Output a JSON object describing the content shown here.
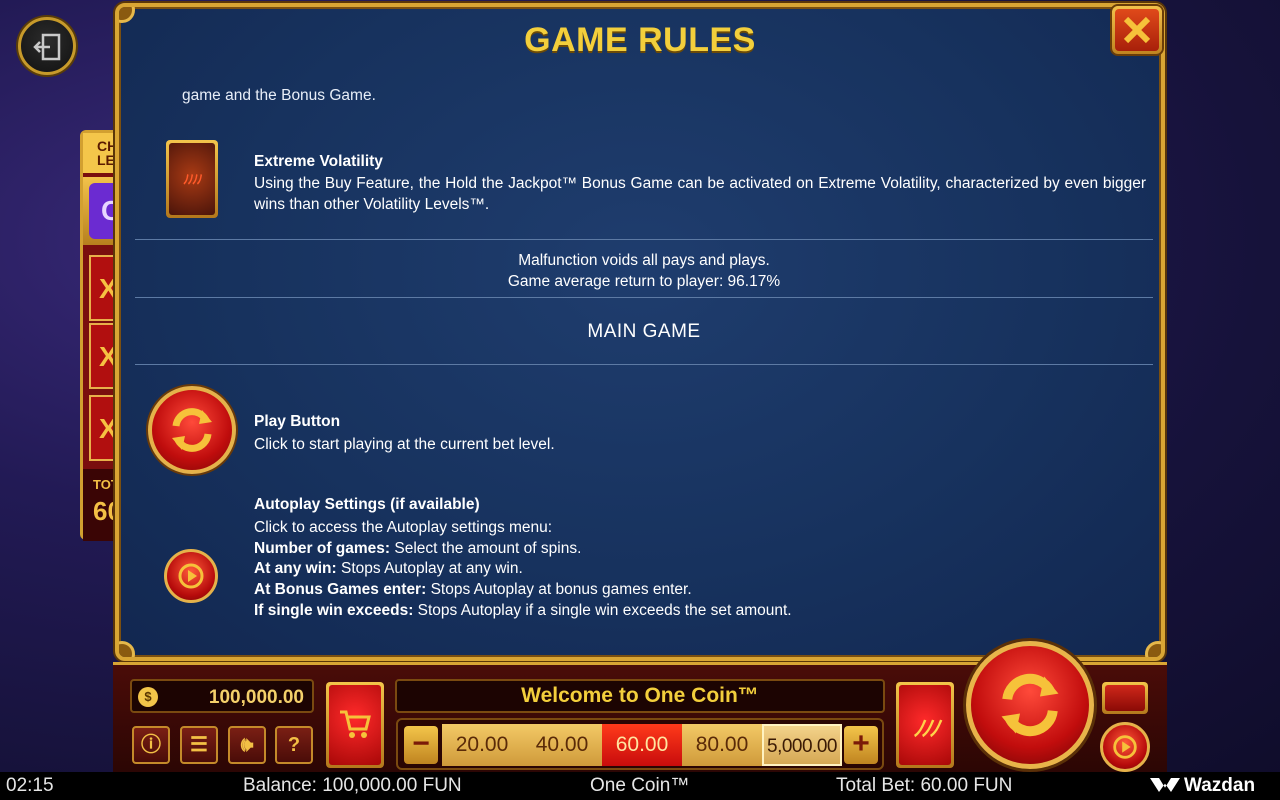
{
  "modal": {
    "title": "GAME RULES",
    "cut_line": "game and the Bonus Game.",
    "extreme_volatility": {
      "title": "Extreme Volatility",
      "desc": "Using the Buy Feature, the Hold the Jackpot™ Bonus Game can be activated on Extreme Volatility, characterized by even bigger wins than other Volatility Levels™."
    },
    "malfunction": "Malfunction voids all pays and plays.",
    "rtp": "Game average return to player: 96.17%",
    "section_main": "MAIN GAME",
    "play_button": {
      "title": "Play Button",
      "desc": "Click to start playing at the current bet level."
    },
    "autoplay": {
      "title": "Autoplay Settings (if available)",
      "intro": "Click to access the Autoplay settings menu:",
      "items": [
        {
          "label": "Number of games:",
          "text": " Select the amount of spins."
        },
        {
          "label": "At any win:",
          "text": " Stops Autoplay at any win."
        },
        {
          "label": "At Bonus Games enter:",
          "text": " Stops Autoplay at bonus games enter."
        },
        {
          "label": "If single win exceeds:",
          "text": " Stops Autoplay if a single win exceeds the set amount."
        }
      ]
    }
  },
  "side_panel": {
    "top": "CH\nLE",
    "purple": "C",
    "cells": [
      "X",
      "X",
      "X"
    ],
    "total_label": "TOT",
    "total_value": "60"
  },
  "bottom": {
    "balance": "100,000.00",
    "welcome": "Welcome to One Coin™",
    "bets": [
      "20.00",
      "40.00",
      "60.00",
      "80.00",
      "5,000.00"
    ],
    "active_bet_index": 2,
    "minus": "−",
    "plus": "+"
  },
  "status": {
    "time": "02:15",
    "balance": "Balance: 100,000.00 FUN",
    "game": "One Coin™",
    "total_bet": "Total Bet: 60.00 FUN",
    "brand": "Wazdan"
  },
  "colors": {
    "accent_gold": "#f3cf3c",
    "modal_bg": "#17325e",
    "active_bet": "#c80c0c"
  }
}
